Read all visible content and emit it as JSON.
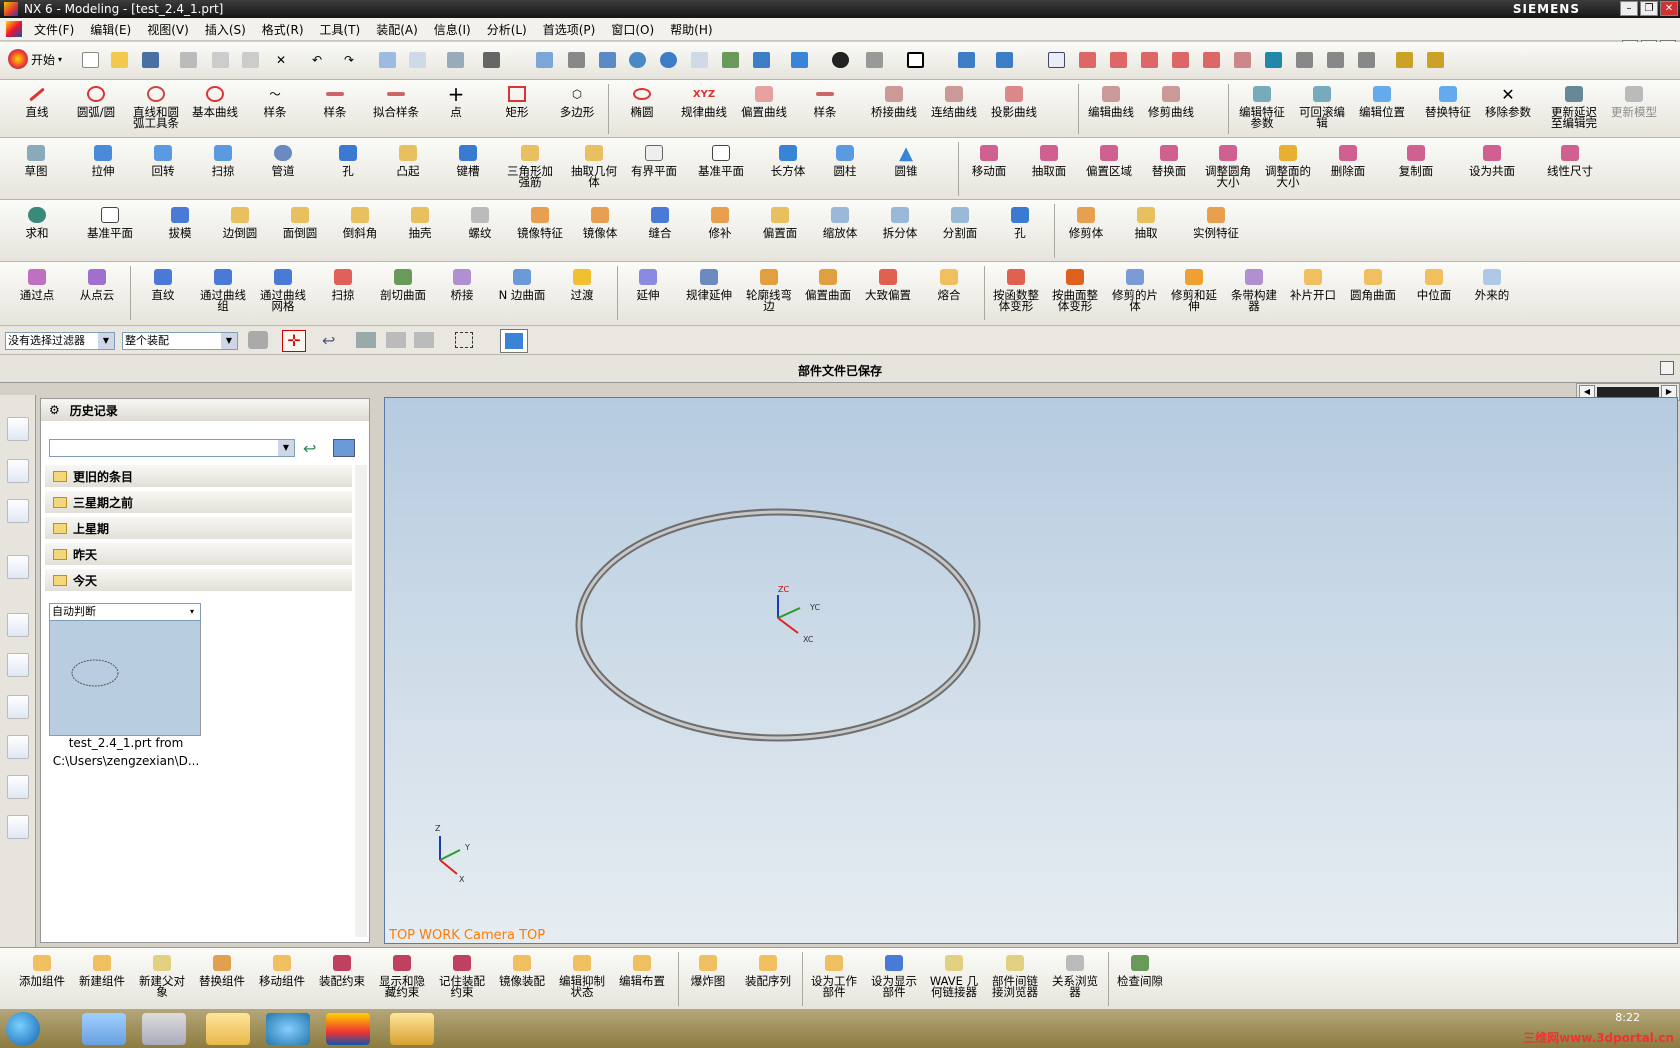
{
  "titlebar": {
    "title": "NX 6 - Modeling - [test_2.4_1.prt]",
    "brand": "SIEMENS",
    "min": "–",
    "max": "❐",
    "close": "✕"
  },
  "menubar": {
    "items": [
      "文件(F)",
      "编辑(E)",
      "视图(V)",
      "插入(S)",
      "格式(R)",
      "工具(T)",
      "装配(A)",
      "信息(I)",
      "分析(L)",
      "首选项(P)",
      "窗口(O)",
      "帮助(H)"
    ]
  },
  "standard": {
    "start_label": "开始"
  },
  "curve_tools": {
    "labels": [
      "直线",
      "圆弧/圆",
      "直线和圆\n弧工具条",
      "基本曲线",
      "样条",
      "样条",
      "拟合样条",
      "点",
      "矩形",
      "多边形",
      "椭圆",
      "规律曲线",
      "偏置曲线",
      "样条",
      "桥接曲线",
      "连结曲线",
      "投影曲线",
      "编辑曲线",
      "修剪曲线",
      "编辑特征\n参数",
      "可回滚编\n辑",
      "编辑位置",
      "替换特征",
      "移除参数",
      "更新延迟\n至编辑完",
      "更新模型"
    ]
  },
  "feature_tools": {
    "labels": [
      "草图",
      "拉伸",
      "回转",
      "扫掠",
      "管道",
      "孔",
      "凸起",
      "键槽",
      "三角形加\n强筋",
      "抽取几何\n体",
      "有界平面",
      "基准平面",
      "长方体",
      "圆柱",
      "圆锥",
      "移动面",
      "抽取面",
      "偏置区域",
      "替换面",
      "调整圆角\n大小",
      "调整面的\n大小",
      "删除面",
      "复制面",
      "设为共面",
      "线性尺寸"
    ]
  },
  "feature_tools2": {
    "labels": [
      "求和",
      "基准平面",
      "拔模",
      "边倒圆",
      "面倒圆",
      "倒斜角",
      "抽壳",
      "螺纹",
      "镜像特征",
      "镜像体",
      "缝合",
      "修补",
      "偏置面",
      "缩放体",
      "拆分体",
      "分割面",
      "孔",
      "修剪体",
      "抽取",
      "实例特征"
    ]
  },
  "surface_tools": {
    "labels": [
      "通过点",
      "从点云",
      "直纹",
      "通过曲线\n组",
      "通过曲线\n网格",
      "扫掠",
      "剖切曲面",
      "桥接",
      "N 边曲面",
      "过渡",
      "延伸",
      "规律延伸",
      "轮廓线弯\n边",
      "偏置曲面",
      "大致偏置",
      "熔合",
      "按函数整\n体变形",
      "按曲面整\n体变形",
      "修剪的片\n体",
      "修剪和延\n伸",
      "条带构建\n器",
      "补片开口",
      "圆角曲面",
      "中位面",
      "外来的"
    ]
  },
  "filterbar": {
    "filter": "没有选择过滤器",
    "scope": "整个装配"
  },
  "status": {
    "message": "部件文件已保存"
  },
  "navigator": {
    "title": "历史记录",
    "groups": [
      "更旧的条目",
      "三星期之前",
      "上星期",
      "昨天",
      "今天"
    ],
    "thumb_mode": "自动判断",
    "file_line1": "test_2.4_1.prt from",
    "file_line2": "C:\\Users\\zengzexian\\D..."
  },
  "viewport": {
    "caption": "TOP WORK Camera TOP",
    "axis_zc": "ZC",
    "axis_yc": "YC",
    "axis_xc": "XC",
    "tri_z": "Z",
    "tri_y": "Y",
    "tri_x": "X"
  },
  "assembly_tools": {
    "labels": [
      "添加组件",
      "新建组件",
      "新建父对\n象",
      "替换组件",
      "移动组件",
      "装配约束",
      "显示和隐\n藏约束",
      "记住装配\n约束",
      "镜像装配",
      "编辑抑制\n状态",
      "编辑布置",
      "爆炸图",
      "装配序列",
      "设为工作\n部件",
      "设为显示\n部件",
      "WAVE 几\n何链接器",
      "部件间链\n接浏览器",
      "关系浏览\n器",
      "检查间隙"
    ]
  },
  "taskbar": {
    "time": "8:22",
    "watermark": "三维网www.3dportal.cn"
  },
  "colors": {
    "viewport_top": "#b6cbe0",
    "viewport_bottom": "#e6edf2",
    "caption": "#ff7a00",
    "titlebar": "#1e1e1e"
  }
}
